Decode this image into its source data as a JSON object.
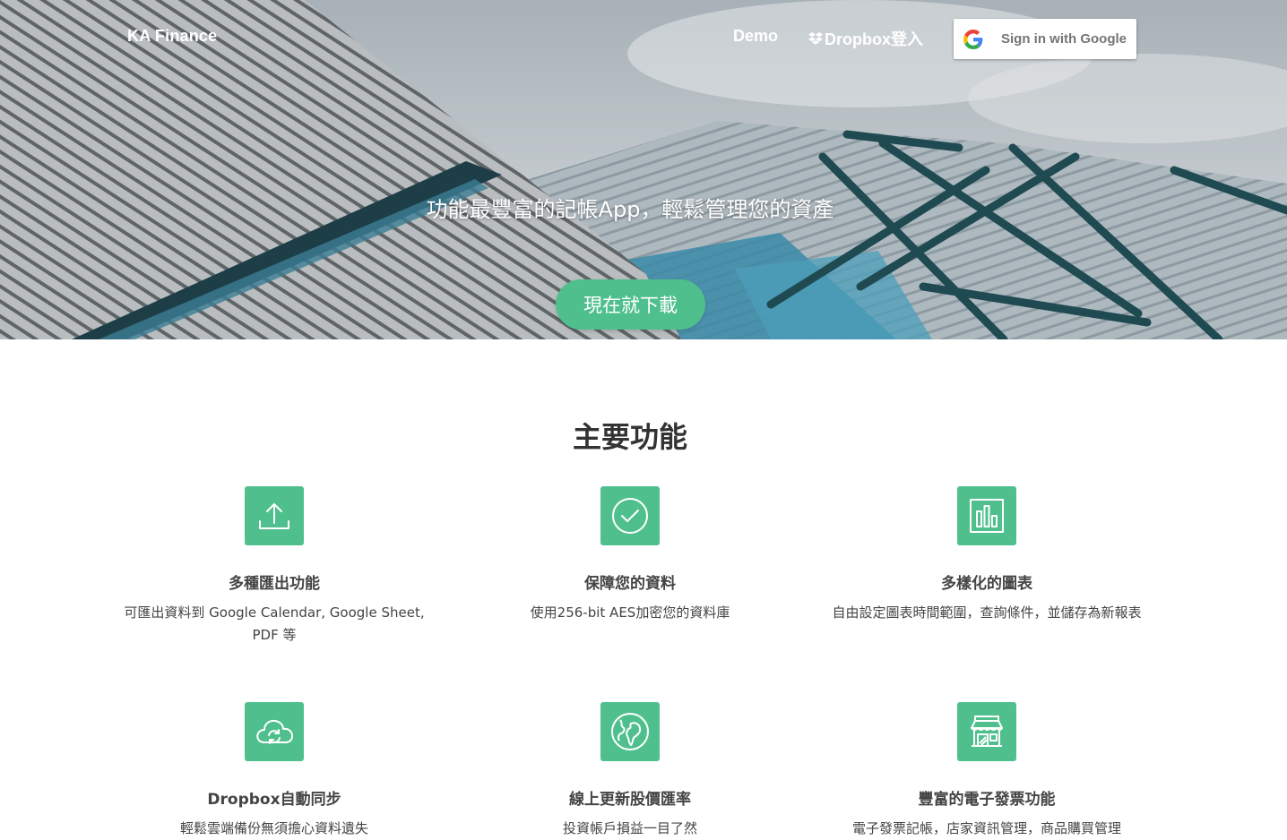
{
  "nav": {
    "brand": "KA Finance",
    "demo": "Demo",
    "dropbox": "Dropbox登入",
    "google_signin": "Sign in with Google"
  },
  "hero": {
    "tagline": "功能最豐富的記帳App，輕鬆管理您的資產",
    "download_button": "現在就下載"
  },
  "features": {
    "title": "主要功能",
    "items": [
      {
        "icon": "export-icon",
        "title": "多種匯出功能",
        "desc": "可匯出資料到 Google Calendar, Google Sheet, PDF 等"
      },
      {
        "icon": "check-circle-icon",
        "title": "保障您的資料",
        "desc": "使用256-bit AES加密您的資料庫"
      },
      {
        "icon": "bar-chart-icon",
        "title": "多樣化的圖表",
        "desc": "自由設定圖表時間範圍，查詢條件，並儲存為新報表"
      },
      {
        "icon": "cloud-sync-icon",
        "title": "Dropbox自動同步",
        "desc": "輕鬆雲端備份無須擔心資料遺失"
      },
      {
        "icon": "globe-icon",
        "title": "線上更新股價匯率",
        "desc": "投資帳戶損益一目了然"
      },
      {
        "icon": "store-icon",
        "title": "豐富的電子發票功能",
        "desc": "電子發票記帳，店家資訊管理，商品購買管理"
      }
    ]
  },
  "colors": {
    "accent": "#4fc08d",
    "heading": "#333333",
    "text": "#444444"
  }
}
